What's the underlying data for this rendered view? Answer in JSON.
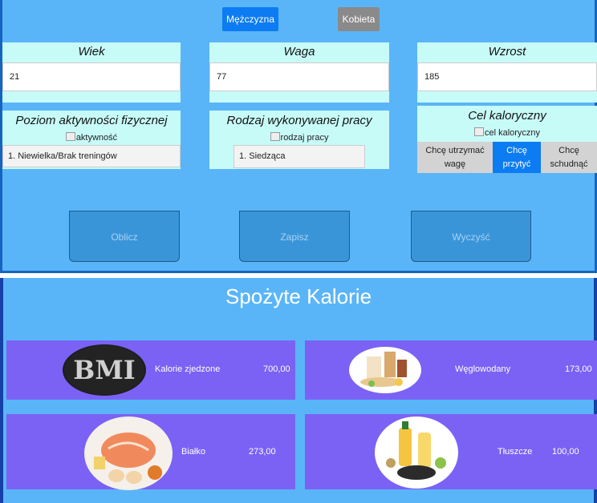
{
  "gender": {
    "male": "Mężczyzna",
    "female": "Kobieta"
  },
  "fields": {
    "age": {
      "label": "Wiek",
      "value": "21"
    },
    "weight": {
      "label": "Waga",
      "value": "77"
    },
    "height": {
      "label": "Wzrost",
      "value": "185"
    }
  },
  "activity": {
    "label": "Poziom aktywności fizycznej",
    "img_alt": "aktywność",
    "selected": "1. Niewielka/Brak treningów"
  },
  "work": {
    "label": "Rodzaj wykonywanej pracy",
    "img_alt": "rodzaj pracy",
    "selected": "1. Siedząca"
  },
  "goal": {
    "label": "Cel kaloryczny",
    "img_alt": "cel kaloryczny",
    "options": [
      "Chcę utrzymać wagę",
      "Chcę przytyć",
      "Chcę schudnąć"
    ],
    "selected_index": 1
  },
  "actions": {
    "calculate": "Oblicz",
    "save": "Zapisz",
    "clear": "Wyczyść"
  },
  "results": {
    "title": "Spożyte Kalorie",
    "bmi_logo": "BMI",
    "calories": {
      "label": "Kalorie zjedzone",
      "value": "700,00"
    },
    "carbs": {
      "label": "Węglowodany",
      "value": "173,00"
    },
    "protein": {
      "label": "Białko",
      "value": "273,00"
    },
    "fat": {
      "label": "Tłuszcze",
      "value": "100,00"
    }
  },
  "colors": {
    "background": "#5ab5f8",
    "panel": "#c7fbf8",
    "active": "#0d7cf2",
    "card": "#7b62f5"
  }
}
